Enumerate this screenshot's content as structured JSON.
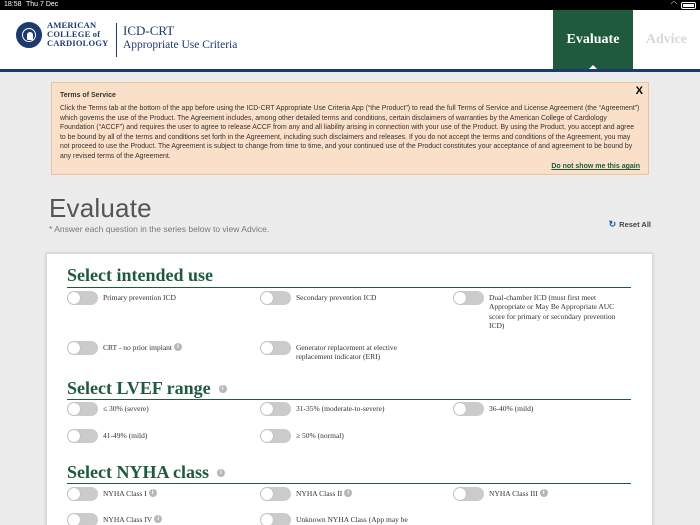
{
  "status": {
    "time": "18:58",
    "date": "Thu 7 Dec"
  },
  "header": {
    "org_line1": "AMERICAN",
    "org_line2": "COLLEGE of",
    "org_line3": "CARDIOLOGY",
    "app_title": "ICD-CRT",
    "app_subtitle": "Appropriate Use Criteria",
    "tabs": [
      {
        "label": "Evaluate",
        "active": true
      },
      {
        "label": "Advice",
        "active": false
      }
    ]
  },
  "terms": {
    "title": "Terms of Service",
    "body": "Click the Terms tab at the bottom of the app before using the ICD-CRT Appropriate Use Criteria App (“the Product”) to read the full Terms of Service and License Agreement (the “Agreement”) which governs the use of the Product. The Agreement includes, among other detailed terms and conditions, certain disclaimers of warranties by the American College of Cardiology Foundation (“ACCF”) and requires the user to agree to release ACCF from any and all liability arising in connection with your use of the Product. By using the Product, you accept and agree to be bound by all of the terms and conditions set forth in the Agreement, including such disclaimers and releases. If you do not accept the terms and conditions of the Agreement, you may not proceed to use the Product. The Agreement is subject to change from time to time, and your continued use of the Product constitutes your acceptance of and agreement to be bound by any revised terms of the Agreement.",
    "close_label": "X",
    "dont_show_label": "Do not show me this again"
  },
  "page": {
    "title": "Evaluate",
    "subtitle": "* Answer each question in the series below to view Advice.",
    "reset_label": "Reset All"
  },
  "sections": {
    "intended_use": {
      "title": "Select intended use",
      "options": [
        "Primary prevention ICD",
        "Secondary prevention ICD",
        "Dual-chamber ICD (must first meet Appropriate or May Be Appropriate AUC score for primary or secondary prevention ICD)",
        "CRT - no prior implant",
        "Generator replacement at elective replacement indicator (ERI)"
      ]
    },
    "lvef": {
      "title": "Select LVEF range",
      "options": [
        "≤ 30% (severe)",
        "31-35% (moderate-to-severe)",
        "36-40% (mild)",
        "41-49% (mild)",
        "≥ 50% (normal)"
      ]
    },
    "nyha": {
      "title": "Select NYHA class",
      "options": [
        "NYHA Class I",
        "NYHA Class II",
        "NYHA Class III",
        "NYHA Class IV",
        "Unknown NYHA Class (App may be"
      ]
    }
  },
  "info_icon_glyph": "i",
  "colors": {
    "brand_green": "#1f5a3c",
    "brand_navy": "#1c3a6e",
    "notice_bg": "#fbe0c9"
  }
}
